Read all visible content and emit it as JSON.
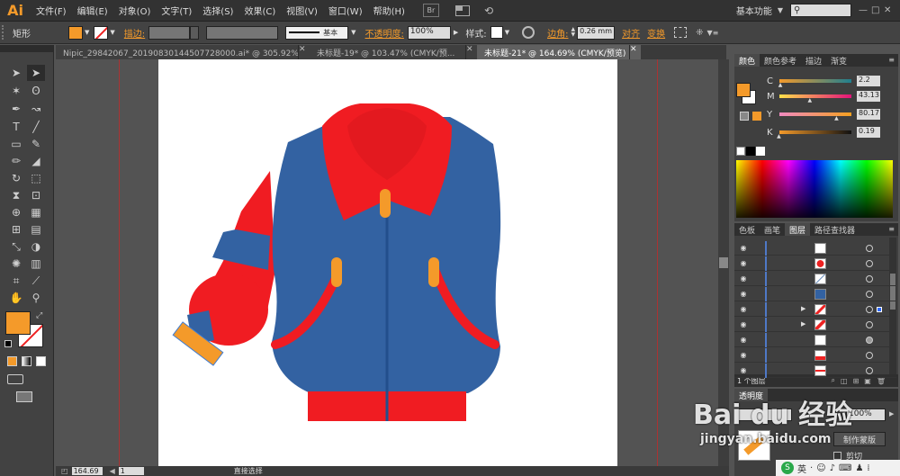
{
  "app": {
    "logo": "Ai"
  },
  "menubar": {
    "items": [
      "文件(F)",
      "编辑(E)",
      "对象(O)",
      "文字(T)",
      "选择(S)",
      "效果(C)",
      "视图(V)",
      "窗口(W)",
      "帮助(H)"
    ],
    "bridge_label": "Br",
    "workspace": "基本功能"
  },
  "control_bar": {
    "selection_type": "矩形",
    "stroke_label": "描边:",
    "stroke_style": "基本",
    "opacity_label": "不透明度:",
    "opacity_value": "100%",
    "style_label": "样式:",
    "corner_label": "边角:",
    "corner_value": "0.26 mm",
    "align_label": "对齐",
    "transform_label": "变换",
    "fill_color": "#f49a2a"
  },
  "tabs": [
    {
      "label": "Nipic_29842067_20190830144507728000.ai* @ 305.92% (RGB/预..."
    },
    {
      "label": "未标题-19* @ 103.47% (CMYK/预..."
    },
    {
      "label": "未标题-21* @ 164.69% (CMYK/预览)"
    }
  ],
  "status": {
    "zoom": "164.69",
    "page": "1",
    "tool": "直接选择"
  },
  "color_panel": {
    "tabs": [
      "颜色",
      "颜色参考",
      "描边",
      "渐变"
    ],
    "channels": [
      {
        "label": "C",
        "value": "2.2",
        "level": 0.022
      },
      {
        "label": "M",
        "value": "43.13",
        "level": 0.4313
      },
      {
        "label": "Y",
        "value": "80.17",
        "level": 0.8017
      },
      {
        "label": "K",
        "value": "0.19",
        "level": 0.0019
      }
    ]
  },
  "layers_panel": {
    "tabs": [
      "色板",
      "画笔",
      "图层",
      "路径查找器"
    ],
    "footer": "1 个图层"
  },
  "transparency_panel": {
    "tab": "透明度",
    "opacity_value": "100%",
    "mask_button": "制作蒙版",
    "clip_label": "剪切"
  },
  "watermark": {
    "brand": "Bai du 经验",
    "url": "jingyan.baidu.com"
  },
  "colors": {
    "jacket_blue": "#3362a2",
    "jacket_red": "#f01c22",
    "accent_orange": "#f49a2a"
  }
}
